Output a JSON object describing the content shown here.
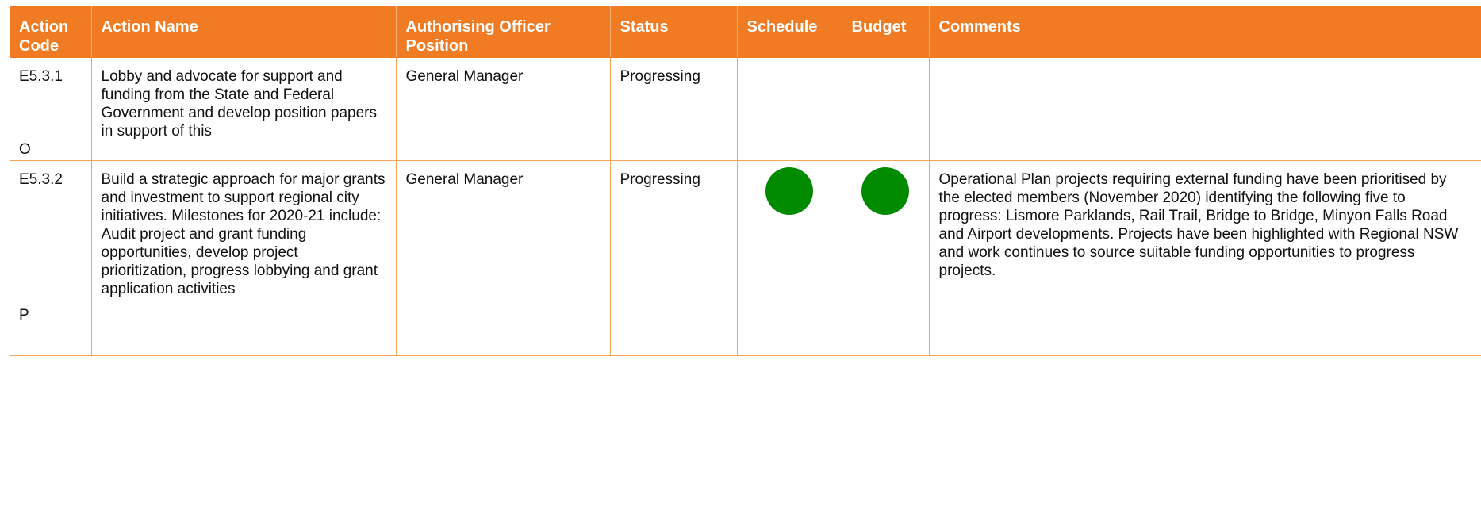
{
  "colors": {
    "header_bg": "#F07B23",
    "border": "#F4A559",
    "status_green": "#008A00"
  },
  "columns": [
    "Action Code",
    "Action Name",
    "Authorising Officer Position",
    "Status",
    "Schedule",
    "Budget",
    "Comments"
  ],
  "rows": [
    {
      "code": "E5.3.1",
      "code_suffix": "O",
      "name": "Lobby and advocate for support and funding from the State and Federal Government and develop position papers in support of this",
      "officer": "General Manager",
      "status": "Progressing",
      "schedule_indicator": "",
      "budget_indicator": "",
      "comments": ""
    },
    {
      "code": "E5.3.2",
      "code_suffix": "P",
      "name": "Build a strategic approach for major grants and investment to support regional city initiatives. Milestones for 2020-21 include:  Audit project and grant funding opportunities, develop project prioritization, progress lobbying and grant application activities",
      "officer": "General Manager",
      "status": "Progressing",
      "schedule_indicator": "green",
      "budget_indicator": "green",
      "comments": "Operational Plan projects requiring external funding have been prioritised by the elected members (November 2020) identifying the following five to progress:  Lismore Parklands, Rail Trail, Bridge to Bridge, Minyon Falls Road and Airport developments. Projects have been highlighted with Regional NSW and work continues to source suitable funding opportunities to progress projects."
    }
  ]
}
